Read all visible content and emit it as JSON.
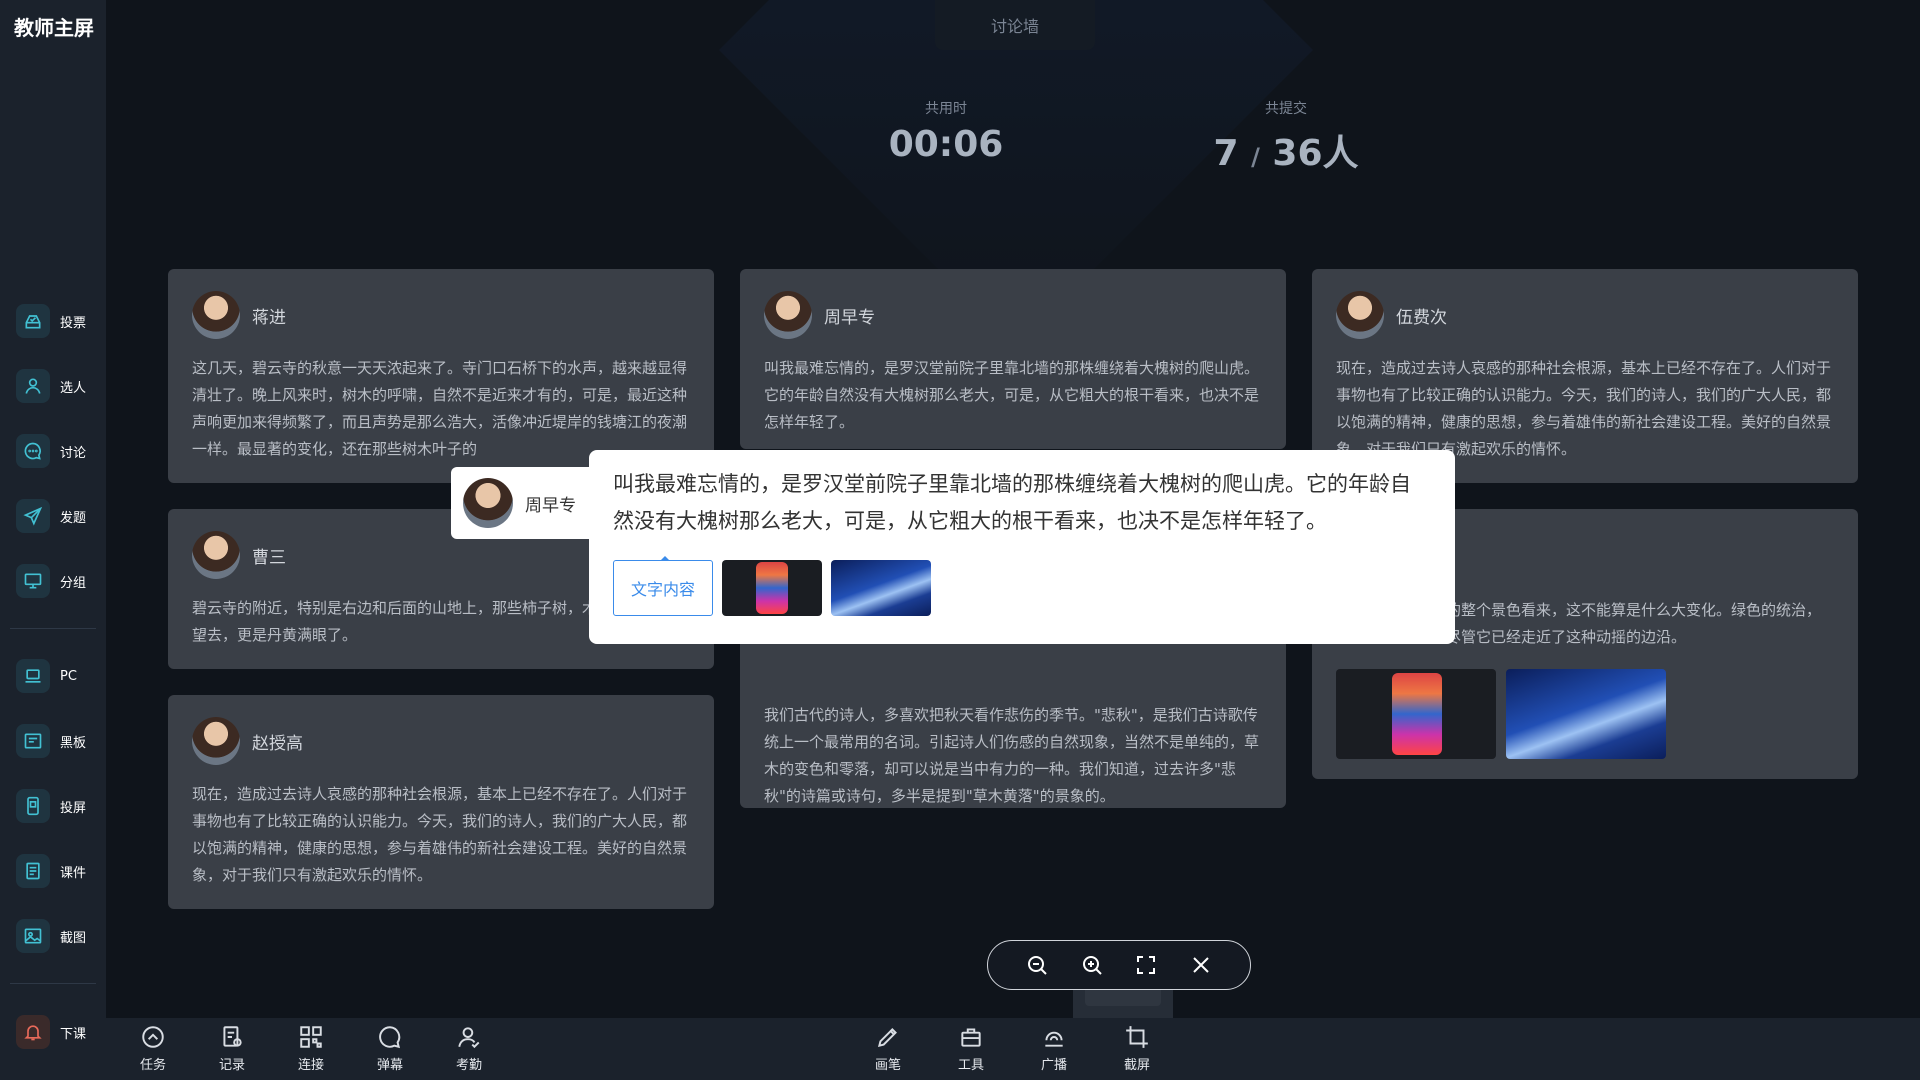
{
  "app_title": "教师主屏",
  "sidebar": {
    "items": [
      {
        "label": "投票",
        "icon": "vote-icon"
      },
      {
        "label": "选人",
        "icon": "person-icon"
      },
      {
        "label": "讨论",
        "icon": "chat-icon"
      },
      {
        "label": "发题",
        "icon": "send-icon"
      },
      {
        "label": "分组",
        "icon": "monitor-icon"
      },
      {
        "label": "PC",
        "icon": "laptop-icon"
      },
      {
        "label": "黑板",
        "icon": "board-icon"
      },
      {
        "label": "投屏",
        "icon": "cast-icon"
      },
      {
        "label": "课件",
        "icon": "document-icon"
      },
      {
        "label": "截图",
        "icon": "image-icon"
      }
    ],
    "end_class_label": "下课"
  },
  "header": {
    "title": "讨论墙",
    "time_label": "共用时",
    "time_value": "00:06",
    "submit_label": "共提交",
    "submit_count": "7",
    "submit_sep": "/",
    "submit_total": "36人"
  },
  "cards": [
    {
      "name": "蒋进",
      "text": "这几天，碧云寺的秋意一天天浓起来了。寺门口石桥下的水声，越来越显得清壮了。晚上风来时，树木的呼啸，自然不是近来才有的，可是，最近这种声响更加来得频繁了，而且声势是那么浩大，活像冲近堤岸的钱塘江的夜潮一样。最显著的变化，还在那些树木叶子的"
    },
    {
      "name": "周早专",
      "text": "叫我最难忘情的，是罗汉堂前院子里靠北墙的那株缠绕着大槐树的爬山虎。它的年龄自然没有大槐树那么老大，可是，从它粗大的根干看来，也决不是怎样年轻了。"
    },
    {
      "name": "伍费次",
      "text": "现在，造成过去诗人哀感的那种社会根源，基本上已经不存在了。人们对于事物也有了比较正确的认识能力。今天，我们的诗人，我们的广大人民，都以饱满的精神，健康的思想，参与着雄伟的新社会建设工程。美好的自然景象，对于我们只有激起欢乐的情怀。"
    },
    {
      "name": "曹三",
      "text": "碧云寺的附近，特别是右边和后面的山地上，那些柿子树，木……我们就近望去，更是丹黄满眼了。"
    },
    {
      "name": "",
      "text": "我们古代的诗人，多喜欢把秋天看作悲伤的季节。\"悲秋\"，是我们古诗歌传统上一个最常用的名词。引起诗人们伤感的自然现象，当然不是单纯的，草木的变色和零落，却可以说是当中有力的一种。我们知道，过去许多\"悲秋\"的诗篇或诗句，多半是提到\"草木黄落\"的景象的。"
    },
    {
      "name": "",
      "text": "的整个景色看来，这不能算是什么大变化。绿色的统治，尽管它已经走近了这种动摇的边沿。"
    },
    {
      "name": "赵授高",
      "text": "现在，造成过去诗人哀感的那种社会根源，基本上已经不存在了。人们对于事物也有了比较正确的认识能力。今天，我们的诗人，我们的广大人民，都以饱满的精神，健康的思想，参与着雄伟的新社会建设工程。美好的自然景象，对于我们只有激起欢乐的情怀。"
    }
  ],
  "popup": {
    "name": "周早专",
    "text": "叫我最难忘情的，是罗汉堂前院子里靠北墙的那株缠绕着大槐树的爬山虎。它的年龄自然没有大槐树那么老大，可是，从它粗大的根干看来，也决不是怎样年轻了。",
    "text_tab": "文字内容"
  },
  "zoombar": [
    "zoom-out-icon",
    "zoom-in-icon",
    "fullscreen-icon",
    "close-icon"
  ],
  "toolbar": {
    "left": [
      {
        "label": "任务",
        "icon": "task-icon"
      },
      {
        "label": "记录",
        "icon": "record-icon"
      },
      {
        "label": "连接",
        "icon": "qrcode-icon"
      },
      {
        "label": "弹幕",
        "icon": "danmaku-icon"
      },
      {
        "label": "考勤",
        "icon": "attendance-icon"
      }
    ],
    "right": [
      {
        "label": "画笔",
        "icon": "pen-icon"
      },
      {
        "label": "工具",
        "icon": "toolbox-icon"
      },
      {
        "label": "广播",
        "icon": "broadcast-icon"
      },
      {
        "label": "截屏",
        "icon": "crop-icon"
      }
    ]
  }
}
